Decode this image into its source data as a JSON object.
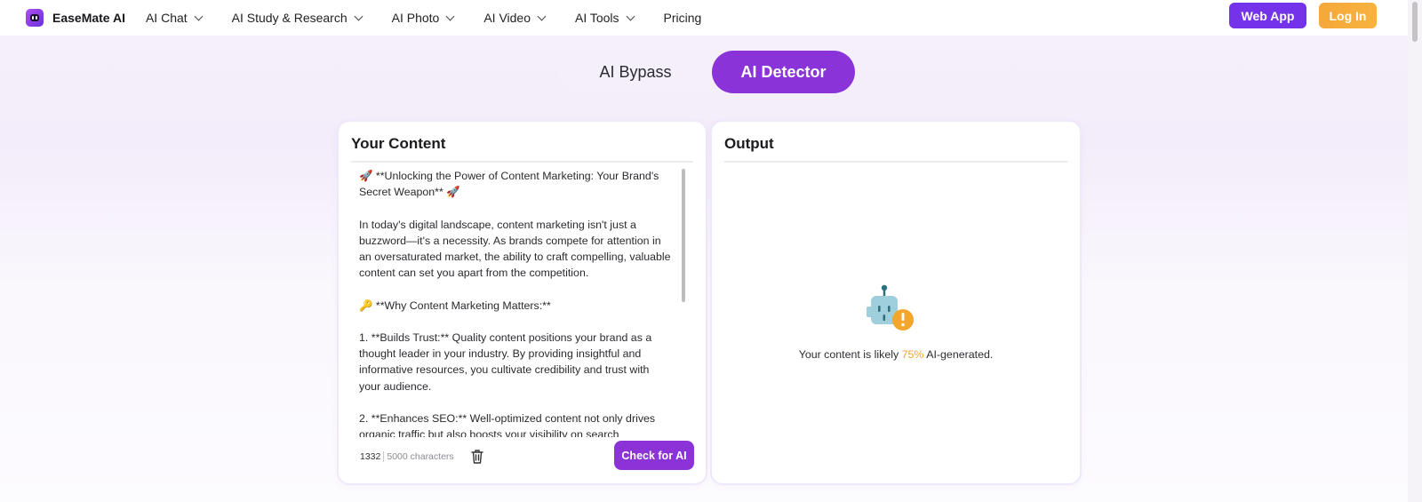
{
  "nav": {
    "brand": "EaseMate AI",
    "menu": [
      {
        "label": "AI Chat",
        "dropdown": true
      },
      {
        "label": "AI Study & Research",
        "dropdown": true
      },
      {
        "label": "AI Photo",
        "dropdown": true
      },
      {
        "label": "AI Video",
        "dropdown": true
      },
      {
        "label": "AI Tools",
        "dropdown": true
      },
      {
        "label": "Pricing",
        "dropdown": false
      }
    ],
    "web_app_label": "Web App",
    "login_label": "Log In"
  },
  "mode_toggle": {
    "tabs": [
      "AI Bypass",
      "AI Detector"
    ],
    "active": "AI Detector"
  },
  "input_panel": {
    "title": "Your Content",
    "content": "🚀 **Unlocking the Power of Content Marketing: Your Brand's Secret Weapon** 🚀\n\nIn today's digital landscape, content marketing isn't just a buzzword—it's a necessity. As brands compete for attention in an oversaturated market, the ability to craft compelling, valuable content can set you apart from the competition.\n\n🔑 **Why Content Marketing Matters:**\n\n1. **Builds Trust:** Quality content positions your brand as a thought leader in your industry. By providing insightful and informative resources, you cultivate credibility and trust with your audience.\n\n2. **Enhances SEO:** Well-optimized content not only drives organic traffic but also boosts your visibility on search",
    "char_count": "1332",
    "char_limit": "5000 characters",
    "check_button": "Check for AI"
  },
  "output_panel": {
    "title": "Output",
    "result_prefix": "Your content is likely ",
    "result_percent": "75%",
    "result_suffix": " AI-generated."
  },
  "colors": {
    "primary": "#8b33d6",
    "web_app": "#7433ea",
    "login": "#f6a83a",
    "percent": "#f0a52f",
    "robot": "#9fcfdc"
  },
  "icons": [
    "logo-icon",
    "chevron-down-icon",
    "trash-icon",
    "robot-warning-icon"
  ]
}
